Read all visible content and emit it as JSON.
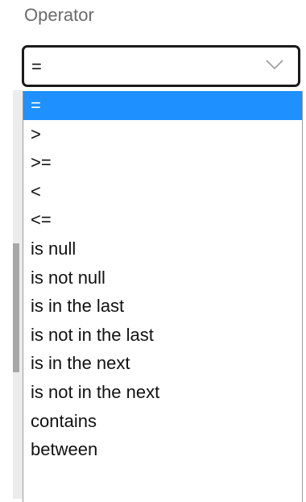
{
  "field": {
    "label": "Operator",
    "selected_value": "=",
    "chevron_icon": "chevron-down-icon",
    "border_color": "#1a1a1a"
  },
  "dropdown": {
    "highlight_color": "#1e90ff",
    "selected_index": 0,
    "options": [
      {
        "label": "="
      },
      {
        "label": ">"
      },
      {
        "label": ">="
      },
      {
        "label": "<"
      },
      {
        "label": "<="
      },
      {
        "label": "is null"
      },
      {
        "label": "is not null"
      },
      {
        "label": "is in the last"
      },
      {
        "label": "is not in the last"
      },
      {
        "label": "is in the next"
      },
      {
        "label": "is not in the next"
      },
      {
        "label": "contains"
      },
      {
        "label": "between"
      }
    ]
  }
}
